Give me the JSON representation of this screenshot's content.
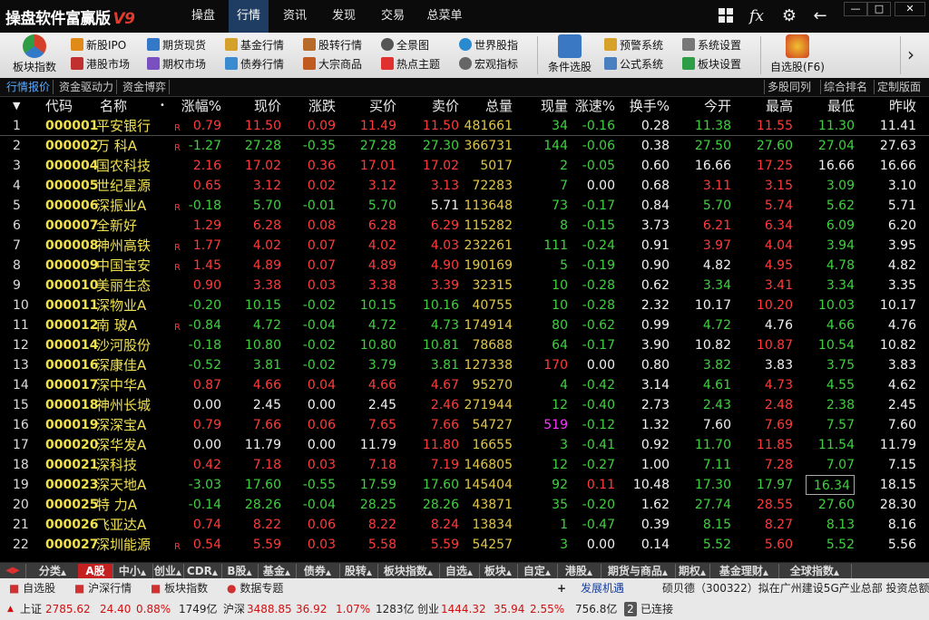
{
  "app": {
    "logo_text": "操盘软件富赢版",
    "logo_version": "V9"
  },
  "top_menu": [
    "操盘",
    "行情",
    "资讯",
    "发现",
    "交易",
    "总菜单"
  ],
  "top_menu_active": 1,
  "window_buttons": [
    "—",
    "□",
    "✕"
  ],
  "toolbar": {
    "big_left": "板块指数",
    "items": [
      "新股IPO",
      "港股市场",
      "期货现货",
      "期权市场",
      "基金行情",
      "债券行情",
      "股转行情",
      "大宗商品",
      "全景图",
      "热点主题",
      "世界股指",
      "宏观指标"
    ],
    "big_mid": "条件选股",
    "items2": [
      "预警系统",
      "公式系统",
      "系统设置",
      "板块设置"
    ],
    "big_right": "自选股(F6)",
    "icon_colors": [
      "#d4402a",
      "#e08a1a",
      "#3478c8",
      "#7a4fc0",
      "#2e9e46",
      "#c03030"
    ]
  },
  "left_tabs": [
    "行情报价",
    "资金驱动力",
    "资金博弈"
  ],
  "right_tabs": [
    "多股同列",
    "综合排名",
    "定制版面"
  ],
  "columns": [
    "代码",
    "名称",
    "涨幅%",
    "现价",
    "涨跌",
    "买价",
    "卖价",
    "总量",
    "现量",
    "涨速%",
    "换手%",
    "今开",
    "最高",
    "最低",
    "昨收"
  ],
  "rows": [
    {
      "idx": "1",
      "code": "000001",
      "name": "平安银行",
      "mark": "R",
      "chg": "0.79",
      "price": "11.50",
      "diff": "0.09",
      "bid": "11.49",
      "ask": "11.50",
      "vol": "481661",
      "cur": "34",
      "spd": "-0.16",
      "turn": "0.28",
      "open": "11.38",
      "high": "11.55",
      "low": "11.30",
      "prev": "11.41"
    },
    {
      "idx": "2",
      "code": "000002",
      "name": "万 科A",
      "mark": "R",
      "chg": "-1.27",
      "price": "27.28",
      "diff": "-0.35",
      "bid": "27.28",
      "ask": "27.30",
      "vol": "366731",
      "cur": "144",
      "spd": "-0.06",
      "turn": "0.38",
      "open": "27.50",
      "high": "27.60",
      "low": "27.04",
      "prev": "27.63"
    },
    {
      "idx": "3",
      "code": "000004",
      "name": "国农科技",
      "mark": "",
      "chg": "2.16",
      "price": "17.02",
      "diff": "0.36",
      "bid": "17.01",
      "ask": "17.02",
      "vol": "5017",
      "cur": "2",
      "spd": "-0.05",
      "turn": "0.60",
      "open": "16.66",
      "high": "17.25",
      "low": "16.66",
      "prev": "16.66"
    },
    {
      "idx": "4",
      "code": "000005",
      "name": "世纪星源",
      "mark": "",
      "chg": "0.65",
      "price": "3.12",
      "diff": "0.02",
      "bid": "3.12",
      "ask": "3.13",
      "vol": "72283",
      "cur": "7",
      "spd": "0.00",
      "turn": "0.68",
      "open": "3.11",
      "high": "3.15",
      "low": "3.09",
      "prev": "3.10"
    },
    {
      "idx": "5",
      "code": "000006",
      "name": "深振业A",
      "mark": "R",
      "chg": "-0.18",
      "price": "5.70",
      "diff": "-0.01",
      "bid": "5.70",
      "ask": "5.71",
      "vol": "113648",
      "cur": "73",
      "spd": "-0.17",
      "turn": "0.84",
      "open": "5.70",
      "high": "5.74",
      "low": "5.62",
      "prev": "5.71"
    },
    {
      "idx": "6",
      "code": "000007",
      "name": "全新好",
      "mark": "",
      "chg": "1.29",
      "price": "6.28",
      "diff": "0.08",
      "bid": "6.28",
      "ask": "6.29",
      "vol": "115282",
      "cur": "8",
      "spd": "-0.15",
      "turn": "3.73",
      "open": "6.21",
      "high": "6.34",
      "low": "6.09",
      "prev": "6.20"
    },
    {
      "idx": "7",
      "code": "000008",
      "name": "神州高铁",
      "mark": "R",
      "chg": "1.77",
      "price": "4.02",
      "diff": "0.07",
      "bid": "4.02",
      "ask": "4.03",
      "vol": "232261",
      "cur": "111",
      "spd": "-0.24",
      "turn": "0.91",
      "open": "3.97",
      "high": "4.04",
      "low": "3.94",
      "prev": "3.95"
    },
    {
      "idx": "8",
      "code": "000009",
      "name": "中国宝安",
      "mark": "R",
      "chg": "1.45",
      "price": "4.89",
      "diff": "0.07",
      "bid": "4.89",
      "ask": "4.90",
      "vol": "190169",
      "cur": "5",
      "spd": "-0.19",
      "turn": "0.90",
      "open": "4.82",
      "high": "4.95",
      "low": "4.78",
      "prev": "4.82"
    },
    {
      "idx": "9",
      "code": "000010",
      "name": "美丽生态",
      "mark": "",
      "chg": "0.90",
      "price": "3.38",
      "diff": "0.03",
      "bid": "3.38",
      "ask": "3.39",
      "vol": "32315",
      "cur": "10",
      "spd": "-0.28",
      "turn": "0.62",
      "open": "3.34",
      "high": "3.41",
      "low": "3.34",
      "prev": "3.35"
    },
    {
      "idx": "10",
      "code": "000011",
      "name": "深物业A",
      "mark": "",
      "chg": "-0.20",
      "price": "10.15",
      "diff": "-0.02",
      "bid": "10.15",
      "ask": "10.16",
      "vol": "40755",
      "cur": "10",
      "spd": "-0.28",
      "turn": "2.32",
      "open": "10.17",
      "high": "10.20",
      "low": "10.03",
      "prev": "10.17"
    },
    {
      "idx": "11",
      "code": "000012",
      "name": "南 玻A",
      "mark": "R",
      "chg": "-0.84",
      "price": "4.72",
      "diff": "-0.04",
      "bid": "4.72",
      "ask": "4.73",
      "vol": "174914",
      "cur": "80",
      "spd": "-0.62",
      "turn": "0.99",
      "open": "4.72",
      "high": "4.76",
      "low": "4.66",
      "prev": "4.76"
    },
    {
      "idx": "12",
      "code": "000014",
      "name": "沙河股份",
      "mark": "",
      "chg": "-0.18",
      "price": "10.80",
      "diff": "-0.02",
      "bid": "10.80",
      "ask": "10.81",
      "vol": "78688",
      "cur": "64",
      "spd": "-0.17",
      "turn": "3.90",
      "open": "10.82",
      "high": "10.87",
      "low": "10.54",
      "prev": "10.82"
    },
    {
      "idx": "13",
      "code": "000016",
      "name": "深康佳A",
      "mark": "",
      "chg": "-0.52",
      "price": "3.81",
      "diff": "-0.02",
      "bid": "3.79",
      "ask": "3.81",
      "vol": "127338",
      "cur": "170",
      "spd": "0.00",
      "turn": "0.80",
      "open": "3.82",
      "high": "3.83",
      "low": "3.75",
      "prev": "3.83"
    },
    {
      "idx": "14",
      "code": "000017",
      "name": "深中华A",
      "mark": "",
      "chg": "0.87",
      "price": "4.66",
      "diff": "0.04",
      "bid": "4.66",
      "ask": "4.67",
      "vol": "95270",
      "cur": "4",
      "spd": "-0.42",
      "turn": "3.14",
      "open": "4.61",
      "high": "4.73",
      "low": "4.55",
      "prev": "4.62"
    },
    {
      "idx": "15",
      "code": "000018",
      "name": "神州长城",
      "mark": "",
      "chg": "0.00",
      "price": "2.45",
      "diff": "0.00",
      "bid": "2.45",
      "ask": "2.46",
      "vol": "271944",
      "cur": "12",
      "spd": "-0.40",
      "turn": "2.73",
      "open": "2.43",
      "high": "2.48",
      "low": "2.38",
      "prev": "2.45"
    },
    {
      "idx": "16",
      "code": "000019",
      "name": "深深宝A",
      "mark": "",
      "chg": "0.79",
      "price": "7.66",
      "diff": "0.06",
      "bid": "7.65",
      "ask": "7.66",
      "vol": "54727",
      "cur": "519",
      "spd": "-0.12",
      "turn": "1.32",
      "open": "7.60",
      "high": "7.69",
      "low": "7.57",
      "prev": "7.60"
    },
    {
      "idx": "17",
      "code": "000020",
      "name": "深华发A",
      "mark": "",
      "chg": "0.00",
      "price": "11.79",
      "diff": "0.00",
      "bid": "11.79",
      "ask": "11.80",
      "vol": "16655",
      "cur": "3",
      "spd": "-0.41",
      "turn": "0.92",
      "open": "11.70",
      "high": "11.85",
      "low": "11.54",
      "prev": "11.79"
    },
    {
      "idx": "18",
      "code": "000021",
      "name": "深科技",
      "mark": "",
      "chg": "0.42",
      "price": "7.18",
      "diff": "0.03",
      "bid": "7.18",
      "ask": "7.19",
      "vol": "146805",
      "cur": "12",
      "spd": "-0.27",
      "turn": "1.00",
      "open": "7.11",
      "high": "7.28",
      "low": "7.07",
      "prev": "7.15"
    },
    {
      "idx": "19",
      "code": "000023",
      "name": "深天地A",
      "mark": "",
      "chg": "-3.03",
      "price": "17.60",
      "diff": "-0.55",
      "bid": "17.59",
      "ask": "17.60",
      "vol": "145404",
      "cur": "92",
      "spd": "0.11",
      "turn": "10.48",
      "open": "17.30",
      "high": "17.97",
      "low": "16.34",
      "prev": "18.15"
    },
    {
      "idx": "20",
      "code": "000025",
      "name": "特 力A",
      "mark": "",
      "chg": "-0.14",
      "price": "28.26",
      "diff": "-0.04",
      "bid": "28.25",
      "ask": "28.26",
      "vol": "43871",
      "cur": "35",
      "spd": "-0.20",
      "turn": "1.62",
      "open": "27.74",
      "high": "28.55",
      "low": "27.60",
      "prev": "28.30"
    },
    {
      "idx": "21",
      "code": "000026",
      "name": "飞亚达A",
      "mark": "",
      "chg": "0.74",
      "price": "8.22",
      "diff": "0.06",
      "bid": "8.22",
      "ask": "8.24",
      "vol": "13834",
      "cur": "1",
      "spd": "-0.47",
      "turn": "0.39",
      "open": "8.15",
      "high": "8.27",
      "low": "8.13",
      "prev": "8.16"
    },
    {
      "idx": "22",
      "code": "000027",
      "name": "深圳能源",
      "mark": "R",
      "chg": "0.54",
      "price": "5.59",
      "diff": "0.03",
      "bid": "5.58",
      "ask": "5.59",
      "vol": "54257",
      "cur": "3",
      "spd": "0.00",
      "turn": "0.14",
      "open": "5.52",
      "high": "5.60",
      "low": "5.52",
      "prev": "5.56"
    }
  ],
  "bottom_tabs": [
    "分类",
    "A股",
    "中小",
    "创业",
    "CDR",
    "B股",
    "基金",
    "债券",
    "股转",
    "板块指数",
    "自选",
    "板块",
    "自定",
    "港股",
    "期货与商品",
    "期权",
    "基金理财",
    "全球指数"
  ],
  "bottom_tab_active": 1,
  "info_bar": {
    "items": [
      "自选股",
      "沪深行情",
      "板块指数",
      "数据专题"
    ],
    "news_label": "发展机遇",
    "news_text": "硕贝德（300322）拟在广州建设5G产业总部  投资总额约"
  },
  "status_bar": {
    "sh_label": "上证",
    "sh_index": "2785.62",
    "sh_chg": "24.40",
    "sh_pct": "0.88%",
    "sh_amt": "1749亿",
    "hs_label": "沪深",
    "hs_index": "3488.85",
    "hs_chg": "36.92",
    "hs_pct": "1.07%",
    "hs_amt": "1283亿",
    "cy_label": "创业",
    "cy_index": "1444.32",
    "cy_chg": "35.94",
    "cy_pct": "2.55%",
    "cy_amt": "756.8亿",
    "conn_count": "2",
    "conn_text": "已连接"
  }
}
